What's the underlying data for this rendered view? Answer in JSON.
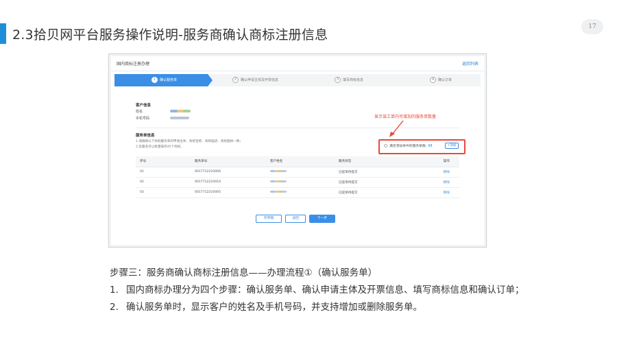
{
  "slide": {
    "title": "2.3拾贝网平台服务操作说明-服务商确认商标注册信息",
    "page_number": "17",
    "accent_color": "#1e8fd6"
  },
  "screenshot": {
    "header_title": "国内商标注册办理",
    "back_link": "返回列表",
    "steps": [
      {
        "num": "1",
        "label": "确认服务单"
      },
      {
        "num": "2",
        "label": "确认申请主体及开票信息"
      },
      {
        "num": "3",
        "label": "填写商标信息"
      },
      {
        "num": "4",
        "label": "确认订单"
      }
    ],
    "customer": {
      "section_title": "客户信息",
      "name_label": "姓名",
      "phone_label": "手机号码"
    },
    "service": {
      "section_title": "服务单信息",
      "note_1": "1.请确保以下商标服务单的申请主体、商标名称、商标描述、商标图样一致；",
      "note_2": "2.您最多可以批量操作45个商标。",
      "annotation": "显示该工单内可增加的服务单数量",
      "available_label": "满足添加条件的服务单数:",
      "available_count": "68",
      "add_button": "+添加",
      "columns": [
        "序号",
        "服务单号",
        "客户姓名",
        "服务状态",
        "操作"
      ],
      "rows": [
        {
          "index": "01",
          "order_no": "0017712210006",
          "status": "已提单待提交",
          "action": "移除"
        },
        {
          "index": "02",
          "order_no": "0017712210010",
          "status": "已提单待提交",
          "action": "移除"
        },
        {
          "index": "03",
          "order_no": "0017712210005",
          "status": "已提单待提交",
          "action": "移除"
        }
      ]
    },
    "buttons": {
      "save": "存草稿",
      "back": "返回",
      "next": "下一步"
    }
  },
  "description": {
    "heading": "步骤三：服务商确认商标注册信息——办理流程①（确认服务单）",
    "items": [
      {
        "num": "1.",
        "text": "国内商标办理分为四个步骤：确认服务单、确认申请主体及开票信息、填写商标信息和确认订单；"
      },
      {
        "num": "2.",
        "text": "确认服务单时，显示客户的姓名及手机号码，并支持增加或删除服务单。"
      }
    ]
  },
  "colors": {
    "primary": "#3a8ee6",
    "annotation": "#e8473c"
  }
}
